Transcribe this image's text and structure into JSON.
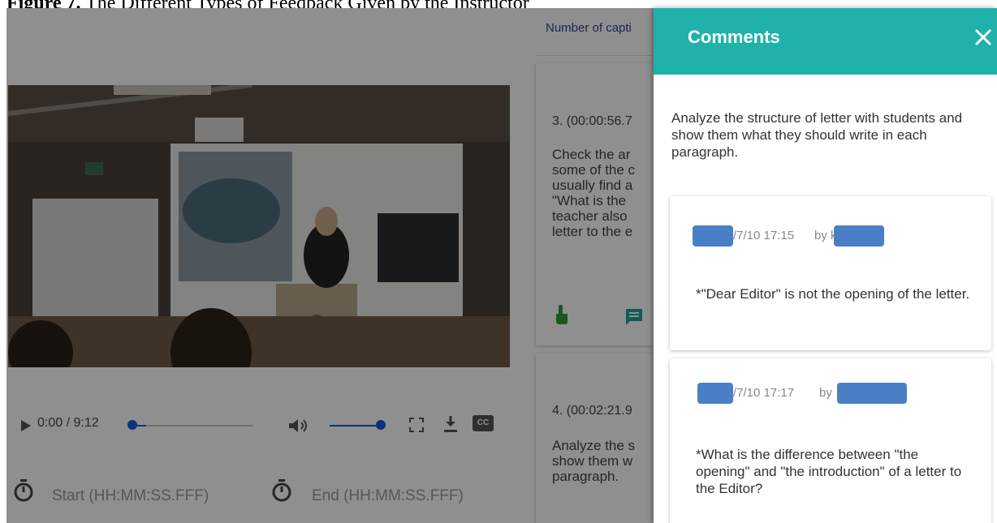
{
  "caption": {
    "prefix": "Figure 7.",
    "text": " The Different Types of Feedback Given by the Instructor"
  },
  "player": {
    "time": "0:00 / 9:12",
    "cc_label": "CC",
    "progress": 0.0
  },
  "time_inputs": {
    "start_placeholder": "Start (HH:MM:SS.FFF)",
    "end_placeholder": "End (HH:MM:SS.FFF)"
  },
  "list": {
    "count_label": "Number of capti",
    "cards": [
      {
        "title": "3. (00:00:56.7",
        "body": "Check the ar\nsome of the c\nusually find a\n\"What is the \nteacher also \nletter to the e"
      },
      {
        "title": "4. (00:02:21.9",
        "body": "Analyze the s\nshow them w\nparagraph."
      }
    ]
  },
  "panel": {
    "title": "Comments",
    "description": "Analyze the structure of letter with students and show them what they should write in each paragraph.",
    "comments": [
      {
        "date": "/7/10 17:15",
        "by": "by",
        "by_tail": "k",
        "text": "*\"Dear Editor\" is not the opening of the letter."
      },
      {
        "date": "/7/10 17:17",
        "by": "by",
        "text": "*What is the difference between \"the opening\" and \"the introduction\" of a letter to the Editor?"
      }
    ]
  },
  "colors": {
    "header": "#20b2aa",
    "accent": "#1a56db",
    "redaction": "#4a7fc7",
    "icon_green": "#2e9e3e",
    "icon_teal": "#1aa59b"
  },
  "icons": [
    "play-icon",
    "volume-icon",
    "fullscreen-icon",
    "download-icon",
    "cc-icon",
    "stopwatch-icon",
    "hand-pointer-icon",
    "chat-icon",
    "close-icon"
  ]
}
